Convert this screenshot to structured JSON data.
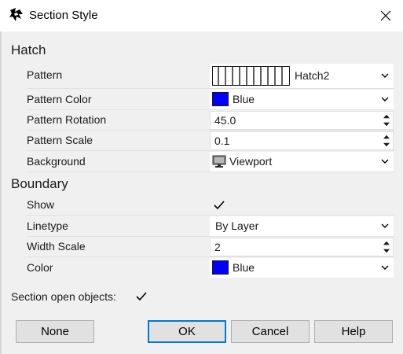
{
  "window": {
    "title": "Section Style"
  },
  "sections": {
    "hatch": {
      "heading": "Hatch",
      "pattern": {
        "label": "Pattern",
        "value": "Hatch2"
      },
      "pattern_color": {
        "label": "Pattern Color",
        "value": "Blue",
        "color": "#0000ff"
      },
      "pattern_rotation": {
        "label": "Pattern Rotation",
        "value": "45.0"
      },
      "pattern_scale": {
        "label": "Pattern Scale",
        "value": "0.1"
      },
      "background": {
        "label": "Background",
        "value": "Viewport"
      }
    },
    "boundary": {
      "heading": "Boundary",
      "show": {
        "label": "Show",
        "checked": true
      },
      "linetype": {
        "label": "Linetype",
        "value": "By Layer"
      },
      "width_scale": {
        "label": "Width Scale",
        "value": "2"
      },
      "color": {
        "label": "Color",
        "value": "Blue",
        "color": "#0000ff"
      }
    }
  },
  "section_open_objects": {
    "label": "Section open objects:",
    "checked": true
  },
  "buttons": {
    "none": "None",
    "ok": "OK",
    "cancel": "Cancel",
    "help": "Help"
  },
  "icons": [
    "app-icon",
    "close-icon",
    "chevron-down-icon",
    "spin-up-icon",
    "spin-down-icon",
    "checkmark-icon",
    "monitor-icon"
  ]
}
